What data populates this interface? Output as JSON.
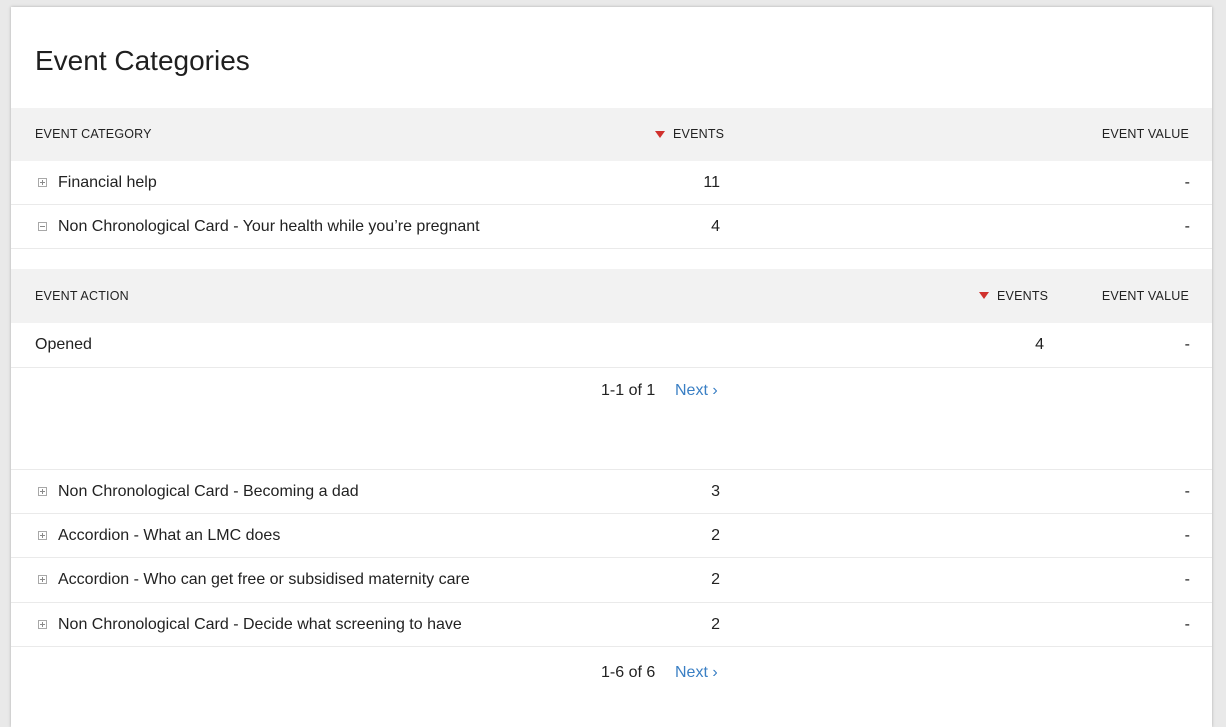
{
  "title": "Event Categories",
  "table": {
    "headers": {
      "category": "EVENT CATEGORY",
      "events": "EVENTS",
      "value": "EVENT VALUE"
    },
    "rows": [
      {
        "label": "Financial help",
        "events": "11",
        "value": "-",
        "expanded": false
      },
      {
        "label": "Non Chronological Card - Your health while you’re pregnant",
        "events": "4",
        "value": "-",
        "expanded": true
      },
      {
        "label": "Non Chronological Card - Becoming a dad",
        "events": "3",
        "value": "-",
        "expanded": false
      },
      {
        "label": "Accordion - What an LMC does",
        "events": "2",
        "value": "-",
        "expanded": false
      },
      {
        "label": "Accordion - Who can get free or subsidised maternity care",
        "events": "2",
        "value": "-",
        "expanded": false
      },
      {
        "label": "Non Chronological Card - Decide what screening to have",
        "events": "2",
        "value": "-",
        "expanded": false
      }
    ],
    "pager": {
      "info": "1-6 of 6",
      "next": "Next ›"
    }
  },
  "subtable": {
    "headers": {
      "action": "EVENT ACTION",
      "events": "EVENTS",
      "value": "EVENT VALUE"
    },
    "rows": [
      {
        "label": "Opened",
        "events": "4",
        "value": "-"
      }
    ],
    "pager": {
      "info": "1-1 of 1",
      "next": "Next ›"
    }
  },
  "colors": {
    "sort_arrow": "#d0312d",
    "link": "#3a7fc4",
    "header_bg": "#f2f2f2"
  }
}
